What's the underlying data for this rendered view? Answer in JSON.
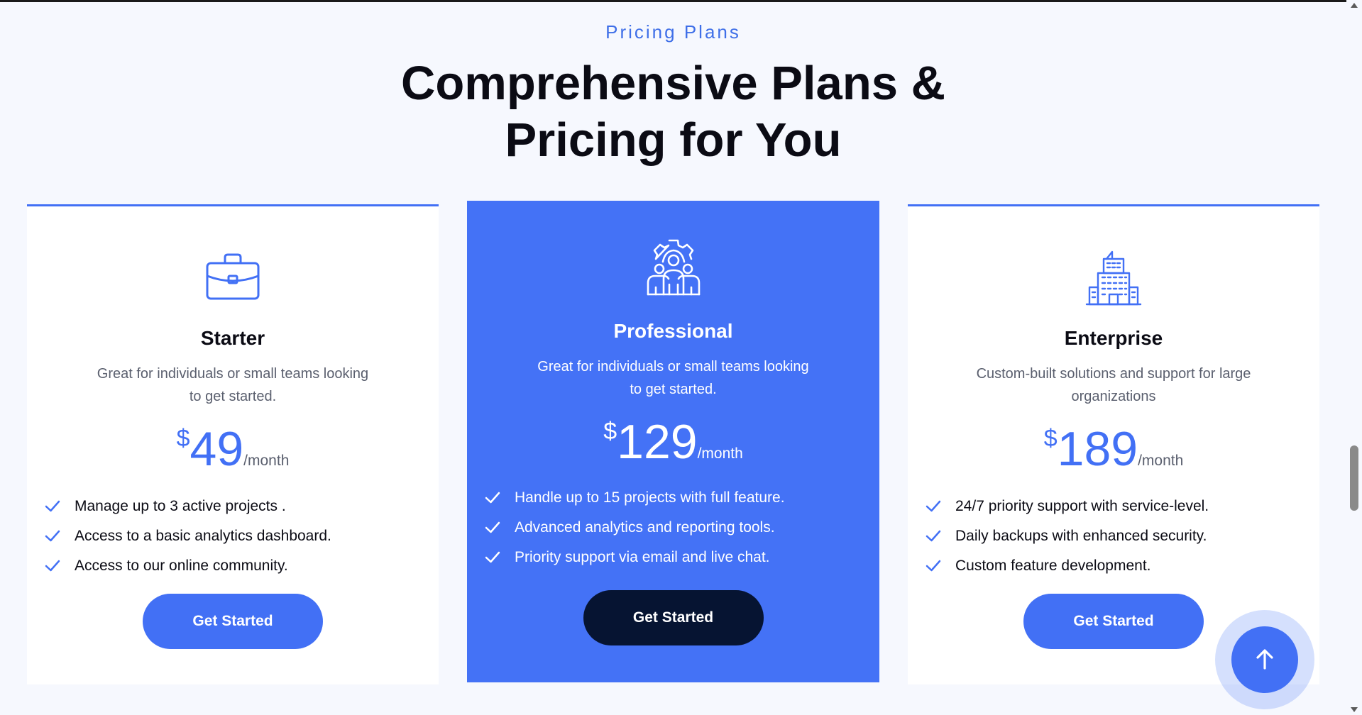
{
  "section": {
    "eyebrow": "Pricing Plans",
    "heading_line1": "Comprehensive Plans &",
    "heading_line2": "Pricing for You"
  },
  "plans": [
    {
      "icon": "briefcase-icon",
      "title": "Starter",
      "description": "Great for individuals or small teams looking to get started.",
      "currency": "$",
      "price": "49",
      "period": "/month",
      "features": [
        "Manage up to 3 active projects .",
        "Access to a basic analytics dashboard.",
        "Access to our online community."
      ],
      "cta": "Get Started"
    },
    {
      "icon": "team-gear-icon",
      "title": "Professional",
      "description": "Great for individuals or small teams looking to get started.",
      "currency": "$",
      "price": "129",
      "period": "/month",
      "features": [
        "Handle up to 15 projects with full feature.",
        "Advanced analytics and reporting tools.",
        "Priority support via email and live chat."
      ],
      "cta": "Get Started"
    },
    {
      "icon": "building-icon",
      "title": "Enterprise",
      "description": "Custom-built solutions and support for large organizations",
      "currency": "$",
      "price": "189",
      "period": "/month",
      "features": [
        "24/7 priority support with service-level.",
        "Daily backups with enhanced security.",
        "Custom feature development."
      ],
      "cta": "Get Started"
    }
  ],
  "scroll_top": {
    "icon": "arrow-up-icon"
  },
  "colors": {
    "accent": "#4270f5",
    "featured_bg": "#4472f6",
    "dark_button": "#061432",
    "page_bg": "#f6f8fe",
    "heading_text": "#0b0b14",
    "muted_text": "#5a5f6e"
  }
}
